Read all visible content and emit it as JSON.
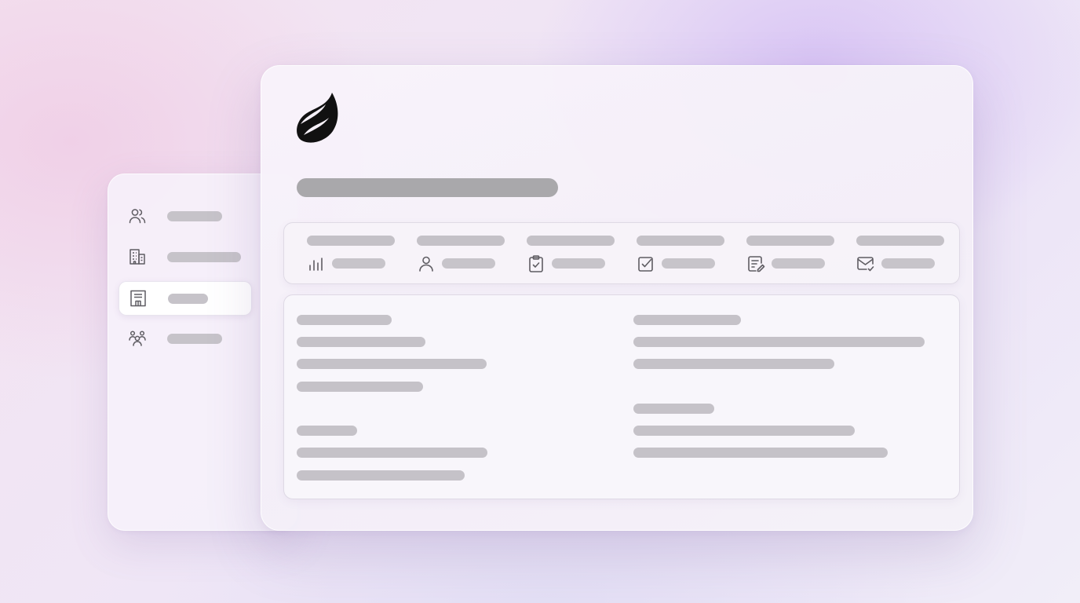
{
  "app": {
    "logo_icon": "flame-logo-icon",
    "page_title": ""
  },
  "sidebar": {
    "items": [
      {
        "icon": "users-icon",
        "label": "",
        "active": false
      },
      {
        "icon": "building-icon",
        "label": "",
        "active": false
      },
      {
        "icon": "storefront-icon",
        "label": "",
        "active": true
      },
      {
        "icon": "team-icon",
        "label": "",
        "active": false
      }
    ]
  },
  "stats": [
    {
      "icon": "bar-chart-icon",
      "label": "",
      "value": ""
    },
    {
      "icon": "person-icon",
      "label": "",
      "value": ""
    },
    {
      "icon": "clipboard-check-icon",
      "label": "",
      "value": ""
    },
    {
      "icon": "checkbox-icon",
      "label": "",
      "value": ""
    },
    {
      "icon": "document-edit-icon",
      "label": "",
      "value": ""
    },
    {
      "icon": "mail-check-icon",
      "label": "",
      "value": ""
    }
  ],
  "details": {
    "left_column": [
      {
        "heading": "",
        "lines": [
          "",
          "",
          ""
        ]
      },
      {
        "heading": "",
        "lines": [
          "",
          ""
        ]
      }
    ],
    "right_column": [
      {
        "heading": "",
        "lines": [
          "",
          ""
        ]
      },
      {
        "heading": "",
        "lines": [
          "",
          ""
        ]
      }
    ]
  },
  "colors": {
    "accent_text": "#a9a8ab",
    "placeholder": "#c5c2c8",
    "icon_stroke": "#5f5d63",
    "logo": "#111111"
  }
}
